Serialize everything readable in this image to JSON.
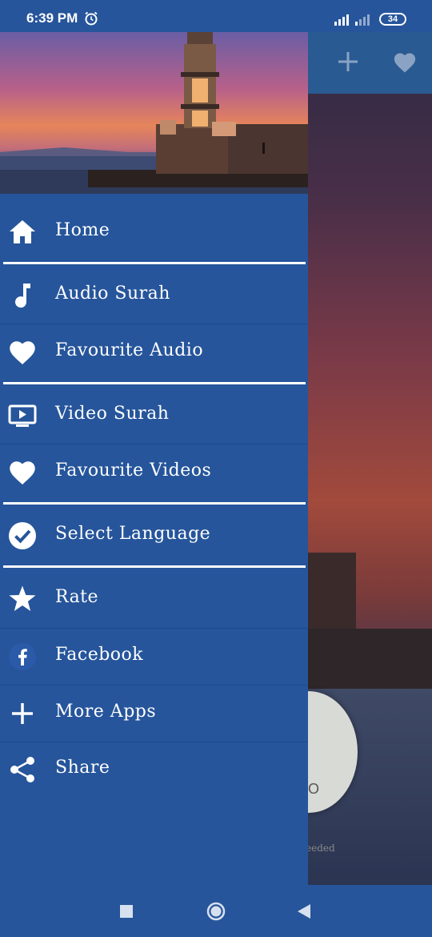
{
  "status_bar": {
    "time": "6:39 PM",
    "battery": "34",
    "icons": [
      "alarm-icon",
      "signal-icon",
      "signal-icon",
      "battery-icon"
    ]
  },
  "background_app": {
    "toolbar_icons": [
      "add-icon",
      "heart-icon"
    ],
    "circle_text": "O",
    "footer_text": "n Needed"
  },
  "drawer": {
    "header_image": "lighthouse-sunset",
    "items": [
      {
        "label": "Home",
        "icon": "home-icon"
      },
      {
        "label": "Audio Surah",
        "icon": "music-note-icon"
      },
      {
        "label": "Favourite Audio",
        "icon": "heart-icon"
      },
      {
        "label": "Video Surah",
        "icon": "tv-play-icon"
      },
      {
        "label": "Favourite Videos",
        "icon": "heart-icon"
      },
      {
        "label": "Select Language",
        "icon": "check-circle-icon"
      },
      {
        "label": "Rate",
        "icon": "star-icon"
      },
      {
        "label": "Facebook",
        "icon": "facebook-icon"
      },
      {
        "label": "More Apps",
        "icon": "plus-icon"
      },
      {
        "label": "Share",
        "icon": "share-icon"
      }
    ]
  },
  "nav_bar": {
    "buttons": [
      "recents-button",
      "home-button",
      "back-button"
    ]
  },
  "colors": {
    "primary": "#26559b",
    "text": "#ffffff"
  }
}
